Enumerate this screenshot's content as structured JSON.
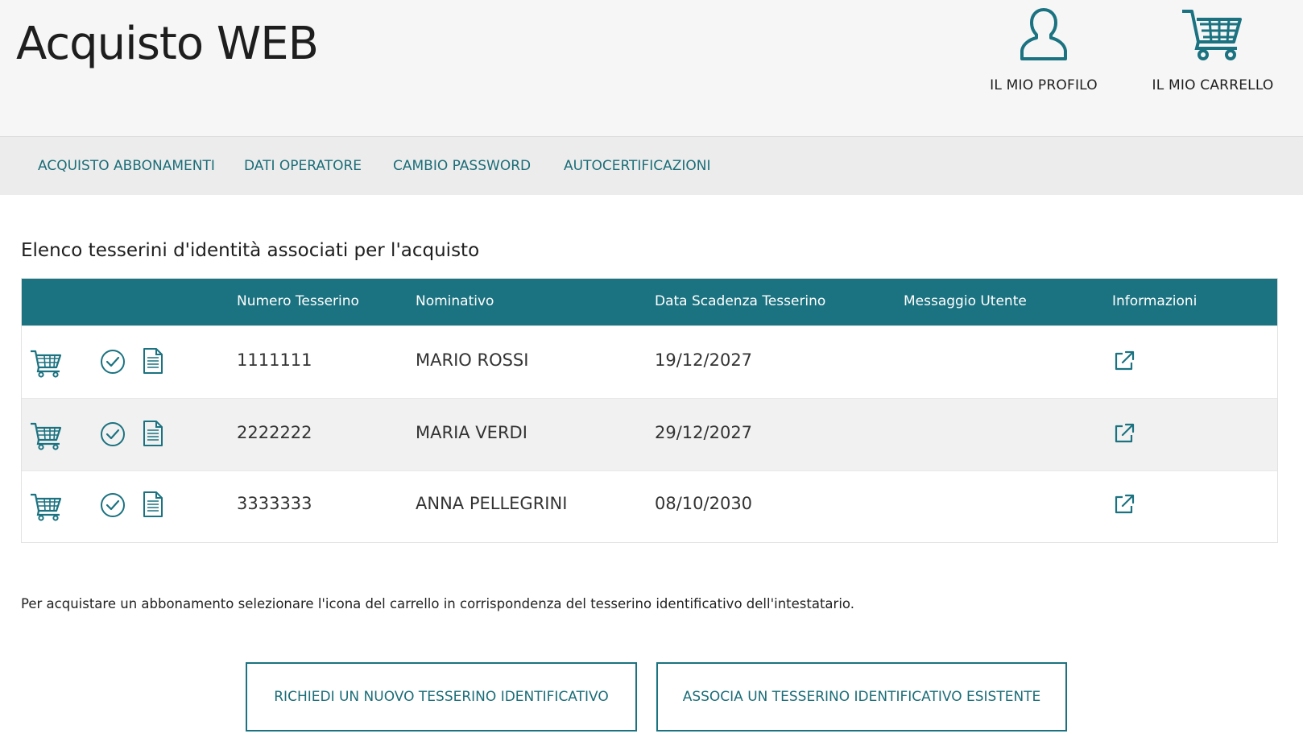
{
  "header": {
    "title": "Acquisto WEB",
    "profile_label": "IL MIO PROFILO",
    "cart_label": "IL MIO CARRELLO"
  },
  "nav": {
    "items": [
      {
        "label": "ACQUISTO ABBONAMENTI"
      },
      {
        "label": "DATI OPERATORE"
      },
      {
        "label": "CAMBIO PASSWORD"
      },
      {
        "label": "AUTOCERTIFICAZIONI"
      }
    ]
  },
  "section": {
    "title": "Elenco tesserini d'identità associati per l'acquisto"
  },
  "table": {
    "columns": [
      "Numero Tesserino",
      "Nominativo",
      "Data Scadenza Tesserino",
      "Messaggio Utente",
      "Informazioni"
    ],
    "rows": [
      {
        "numero": "1111111",
        "nominativo": "MARIO ROSSI",
        "scadenza": "19/12/2027",
        "messaggio": ""
      },
      {
        "numero": "2222222",
        "nominativo": "MARIA VERDI",
        "scadenza": "29/12/2027",
        "messaggio": ""
      },
      {
        "numero": "3333333",
        "nominativo": "ANNA PELLEGRINI",
        "scadenza": "08/10/2030",
        "messaggio": ""
      }
    ],
    "row_icons": [
      "cart-icon",
      "check-circle-icon",
      "document-icon",
      "external-link-icon"
    ]
  },
  "note": {
    "text": "Per acquistare un abbonamento selezionare l'icona del carrello in corrispondenza del tesserino identificativo dell'intestatario."
  },
  "actions": {
    "request_label": "RICHIEDI UN NUOVO TESSERINO IDENTIFICATIVO",
    "associate_label": "ASSOCIA UN TESSERINO IDENTIFICATIVO ESISTENTE"
  },
  "colors": {
    "accent": "#1b7280",
    "link": "#1b6d78",
    "header_bg": "#f6f6f6",
    "nav_bg": "#ececec",
    "row_alt_bg": "#f1f1f1"
  }
}
